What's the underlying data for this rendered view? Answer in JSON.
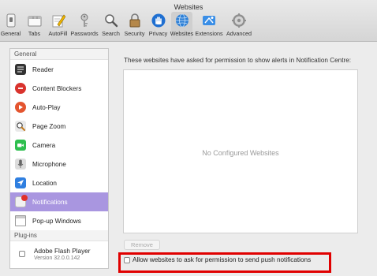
{
  "window": {
    "title": "Websites"
  },
  "toolbar": {
    "items": [
      {
        "label": "General",
        "icon": "general-switch-icon"
      },
      {
        "label": "Tabs",
        "icon": "tabs-icon"
      },
      {
        "label": "AutoFill",
        "icon": "autofill-pencil-icon"
      },
      {
        "label": "Passwords",
        "icon": "key-icon"
      },
      {
        "label": "Search",
        "icon": "magnifier-icon"
      },
      {
        "label": "Security",
        "icon": "padlock-icon"
      },
      {
        "label": "Privacy",
        "icon": "hand-icon"
      },
      {
        "label": "Websites",
        "icon": "globe-icon",
        "active": true
      },
      {
        "label": "Extensions",
        "icon": "puzzle-icon"
      },
      {
        "label": "Advanced",
        "icon": "gear-icon"
      }
    ]
  },
  "sidebar": {
    "general_header": "General",
    "items": [
      {
        "label": "Reader",
        "icon": "reader-icon"
      },
      {
        "label": "Content Blockers",
        "icon": "content-blockers-icon"
      },
      {
        "label": "Auto-Play",
        "icon": "play-icon"
      },
      {
        "label": "Page Zoom",
        "icon": "zoom-icon"
      },
      {
        "label": "Camera",
        "icon": "camera-icon"
      },
      {
        "label": "Microphone",
        "icon": "microphone-icon"
      },
      {
        "label": "Location",
        "icon": "location-arrow-icon"
      },
      {
        "label": "Notifications",
        "icon": "notifications-icon",
        "selected": true
      },
      {
        "label": "Pop-up Windows",
        "icon": "popup-window-icon"
      }
    ],
    "plugins_header": "Plug-ins",
    "plugins": [
      {
        "name": "Adobe Flash Player",
        "version": "Version 32.0.0.142",
        "checked": false
      }
    ]
  },
  "main": {
    "description": "These websites have asked for permission to show alerts in Notification Centre:",
    "empty_state": "No Configured Websites",
    "remove_label": "Remove",
    "allow_label": "Allow websites to ask for permission to send push notifications",
    "allow_checked": false
  },
  "colors": {
    "selection": "#a996e0",
    "highlight_border": "#e00000"
  }
}
